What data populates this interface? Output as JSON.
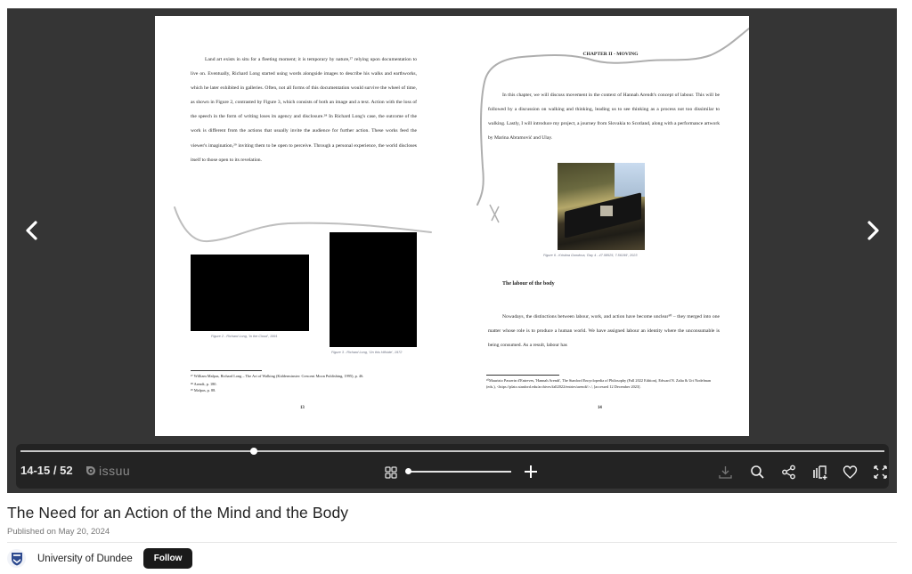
{
  "document": {
    "title": "The Need for an Action of the Mind and the Body",
    "published": "Published on May 20, 2024",
    "publisher": "University of Dundee",
    "follow_label": "Follow"
  },
  "viewer": {
    "page_indicator": "14-15 / 52",
    "brand": "issuu",
    "current_pages": "14-15",
    "total_pages": 52,
    "progress_fraction": 0.27,
    "zoom_fraction": 0.0
  },
  "icons": {
    "prev": "chevron-left-icon",
    "next": "chevron-right-icon",
    "grid": "grid-icon",
    "zoom_in": "plus-icon",
    "download": "download-icon",
    "search": "search-icon",
    "share": "share-icon",
    "add_to_stack": "add-to-stack-icon",
    "like": "heart-icon",
    "fullscreen": "fullscreen-icon"
  },
  "left_page": {
    "paragraph": "Land art exists in situ for a fleeting moment; it is temporary by nature,²⁷ relying upon documentation to live on. Eventually, Richard Long started using words alongside images to describe his walks and earthworks, which he later exhibited in galleries. Often, not all forms of this documentation would survive the wheel of time, as shown in Figure 2, contrasted by Figure 3, which consists of both an image and a text. Action with the loss of the speech in the form of writing loses its agency and disclosure.²⁸ In Richard Long's case, the outcome of the work is different from the actions that usually invite the audience for further action. These works feed the viewer's imagination,²⁹ inviting them to be open to perceive. Through a personal experience, the world discloses itself to those open to its revelation.",
    "caption_fig2": "Figure 2 - Richard Long, 'In the Cloud', 1991",
    "caption_fig3": "Figure 3 - Richard Long, 'On this Hillside', 1972",
    "footnotes": [
      "²⁷ William Malpas, Richard Long – The Art of Walking (Kidderminster: Crescent Moon Publishing, 1995), p. 46.",
      "²⁸ Arendt, p. 180.",
      "²⁹ Malpas, p. 88."
    ],
    "page_number": "13"
  },
  "right_page": {
    "chapter": "CHAPTER II - MOVING",
    "intro": "In this chapter, we will discuss movement in the context of Hannah Arendt's concept of labour. This will be followed by a discussion on walking and thinking, leading us to see thinking as a process not too dissimilar to walking. Lastly, I will introduce my project, a journey from Slovakia to Scotland, along with a performance artwork by Marina Abramović and Ulay.",
    "caption_fig6": "Figure 6 - Kristina Gondova, 'Day 4 - 47.58525, 7.56199', 2023",
    "section_heading": "The labour of the body",
    "paragraph": "Nowadays, the distinctions between labour, work, and action have become unclear³⁰ – they merged into one matter whose role is to produce a human world. We have assigned labour an identity where the unconsumable is being consumed. As a result, labour has",
    "footnotes": [
      "³⁰Maurizio Passerin d'Entreves, 'Hannah Arendt', The Stanford Encyclopedia of Philosophy (Fall 2022 Edition), Edward N. Zalta & Uri Nodelman (eds.), <https://plato.stanford.edu/archives/fall2022/entries/arendt/>./, [accessed 12 December 2023]."
    ],
    "page_number": "14"
  },
  "colors": {
    "viewer_bg": "#353535",
    "control_bar_bg": "#232323",
    "follow_bg": "#1a1a1a",
    "title_text": "#222222",
    "muted_text": "#777777"
  }
}
